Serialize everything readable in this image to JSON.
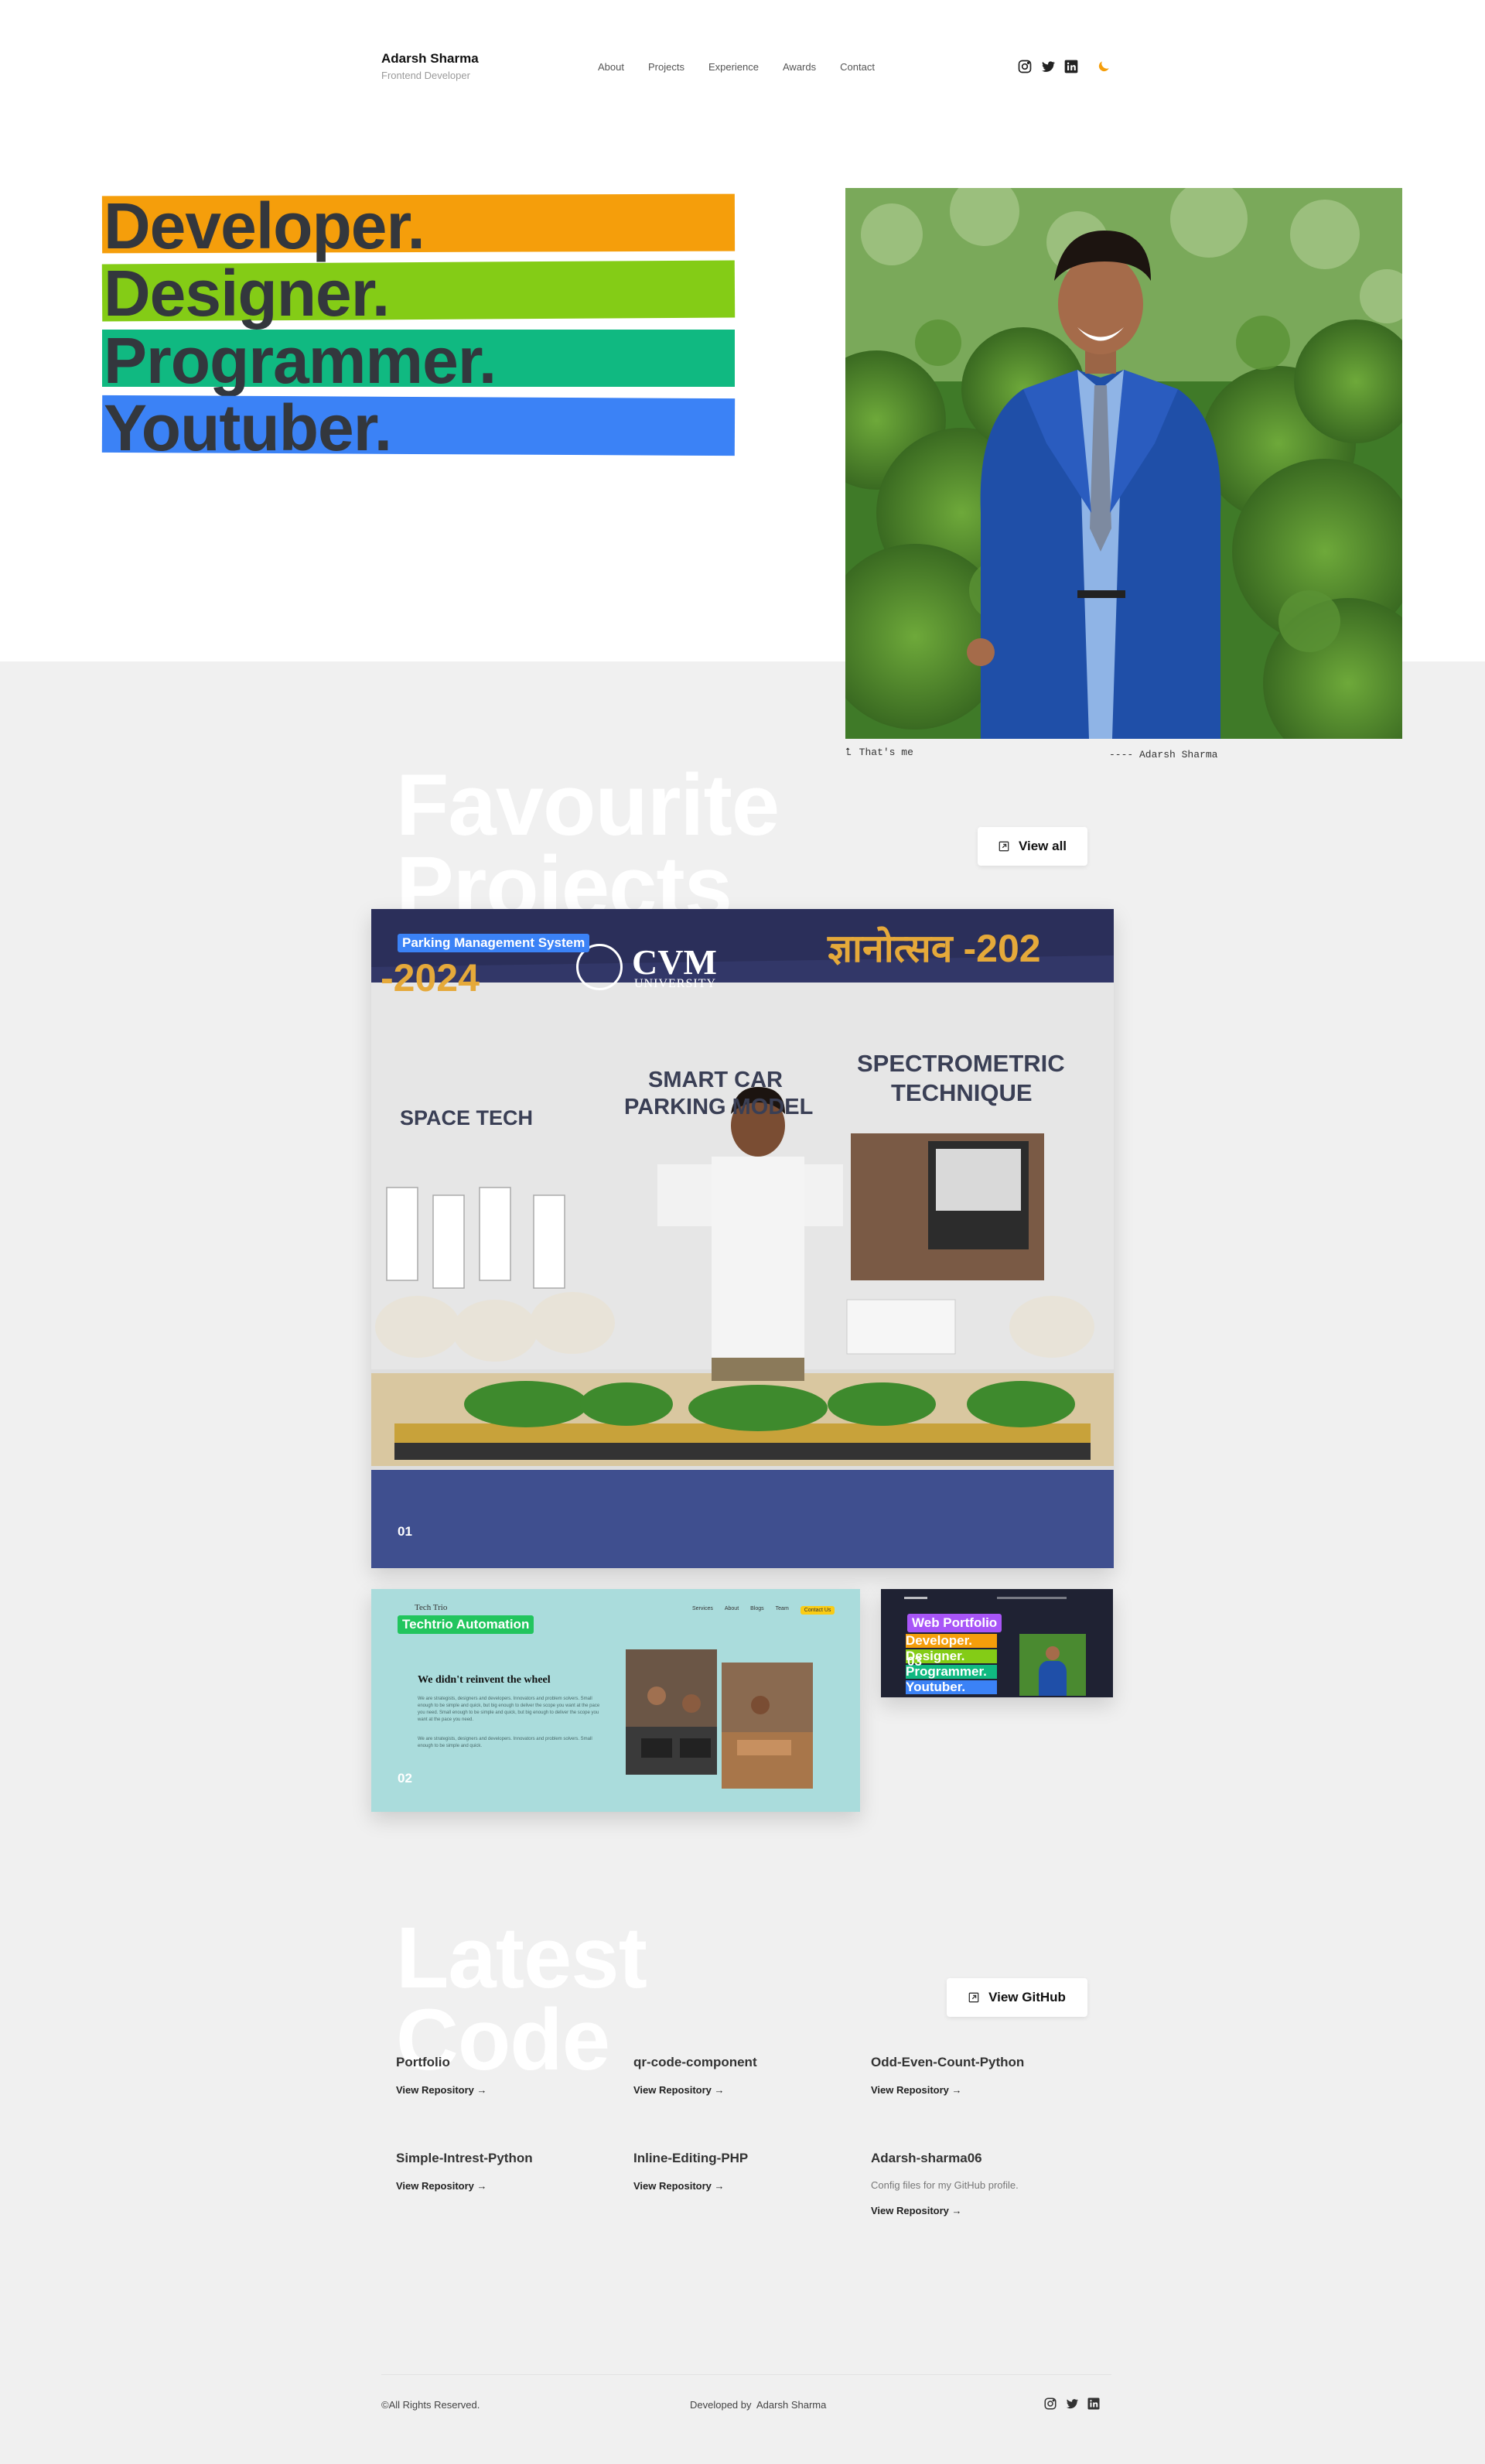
{
  "header": {
    "name": "Adarsh Sharma",
    "role": "Frontend Developer",
    "nav": [
      "About",
      "Projects",
      "Experience",
      "Awards",
      "Contact"
    ],
    "social_icons": [
      "instagram-icon",
      "twitter-icon",
      "linkedin-icon"
    ],
    "theme_icon": "moon-icon"
  },
  "hero": {
    "lines": [
      {
        "text": "Developer.",
        "color": "#f59e0b"
      },
      {
        "text": "Designer.",
        "color": "#84cc16"
      },
      {
        "text": "Programmer.",
        "color": "#10b981"
      },
      {
        "text": "Youtuber.",
        "color": "#3b82f6"
      }
    ],
    "caption_left": "That's me",
    "caption_right": "---- Adarsh Sharma"
  },
  "projects": {
    "title_line1": "Favourite",
    "title_line2": "Projects",
    "view_all": "View all",
    "items": [
      {
        "tag": "Parking Management System",
        "tag_color": "#3b82f6",
        "number": "01"
      },
      {
        "tag": "Techtrio Automation",
        "tag_color": "#22c55e",
        "number": "02"
      },
      {
        "tag": "Web Portfolio",
        "tag_color": "#a855f7",
        "number": "03"
      }
    ],
    "banner": {
      "left": "-2024",
      "university": "CVM",
      "university_sub": "UNIVERSITY",
      "right": "ज्ञानोत्सव -202"
    },
    "booth_labels": [
      "SPACE TECH",
      "SMART CAR",
      "PARKING MODEL",
      "SPECTROMETRIC",
      "TECHNIQUE"
    ],
    "techtrio": {
      "logo": "Tech Trio",
      "nav": [
        "Services",
        "About",
        "Blogs",
        "Team"
      ],
      "cta": "Contact Us",
      "heading": "We didn't reinvent the wheel",
      "para1": "We are strategists, designers and developers. Innovators and problem solvers. Small enough to be simple and quick, but big enough to deliver the scope you want at the pace you need. Small enough to be simple and quick, but big enough to deliver the scope you want at the pace you need.",
      "para2": "We are strategists, designers and developers. Innovators and problem solvers. Small enough to be simple and quick."
    },
    "mini_portfolio": [
      "Developer.",
      "Designer.",
      "Programmer.",
      "Youtuber."
    ]
  },
  "code": {
    "title_line1": "Latest",
    "title_line2": "Code",
    "button": "View GitHub",
    "link_label": "View Repository →",
    "repos": [
      {
        "name": "Portfolio",
        "desc": ""
      },
      {
        "name": "qr-code-component",
        "desc": ""
      },
      {
        "name": "Odd-Even-Count-Python",
        "desc": ""
      },
      {
        "name": "Simple-Intrest-Python",
        "desc": ""
      },
      {
        "name": "Inline-Editing-PHP",
        "desc": ""
      },
      {
        "name": "Adarsh-sharma06",
        "desc": "Config files for my GitHub profile."
      }
    ]
  },
  "footer": {
    "copyright": "©All Rights Reserved.",
    "developed_by": "Developed by",
    "developer": "Adarsh Sharma"
  }
}
